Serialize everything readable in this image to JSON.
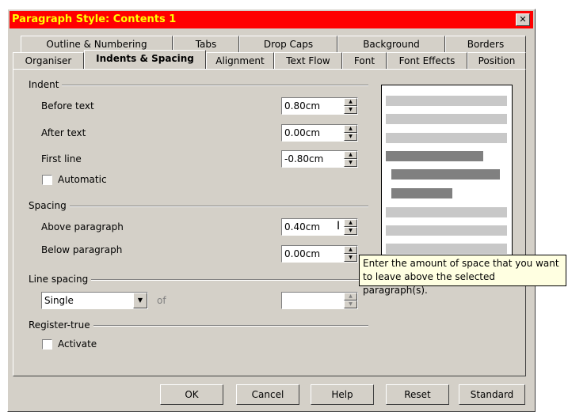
{
  "dialog": {
    "title": "Paragraph Style: Contents 1",
    "close_glyph": "✕"
  },
  "tabs_row1": [
    {
      "label": "Outline & Numbering"
    },
    {
      "label": "Tabs"
    },
    {
      "label": "Drop Caps"
    },
    {
      "label": "Background"
    },
    {
      "label": "Borders"
    }
  ],
  "tabs_row2": [
    {
      "label": "Organiser"
    },
    {
      "label": "Indents & Spacing",
      "active": true
    },
    {
      "label": "Alignment"
    },
    {
      "label": "Text Flow"
    },
    {
      "label": "Font"
    },
    {
      "label": "Font Effects"
    },
    {
      "label": "Position"
    }
  ],
  "indent": {
    "group_label": "Indent",
    "before_text_label": "Before text",
    "before_text_value": "0.80cm",
    "after_text_label": "After text",
    "after_text_value": "0.00cm",
    "first_line_label": "First line",
    "first_line_value": "-0.80cm",
    "automatic_label": "Automatic"
  },
  "spacing": {
    "group_label": "Spacing",
    "above_label": "Above paragraph",
    "above_value": "0.40cm",
    "below_label": "Below paragraph",
    "below_value": "0.00cm"
  },
  "line_spacing": {
    "group_label": "Line spacing",
    "selected": "Single",
    "of_label": "of",
    "of_value": ""
  },
  "register_true": {
    "group_label": "Register-true",
    "activate_label": "Activate"
  },
  "tooltip": {
    "line1": "Enter the amount of space that you want",
    "line2": "to leave above the selected paragraph(s)."
  },
  "buttons": {
    "ok": "OK",
    "cancel": "Cancel",
    "help": "Help",
    "reset": "Reset",
    "standard": "Standard"
  },
  "icons": {
    "spin_up": "▲",
    "spin_down": "▼",
    "dropdown": "▼",
    "text_cursor": "I"
  },
  "colors": {
    "titlebar_bg": "#ff0000",
    "titlebar_text": "#ffff00",
    "dialog_bg": "#d4d0c8",
    "tooltip_bg": "#ffffe1"
  }
}
